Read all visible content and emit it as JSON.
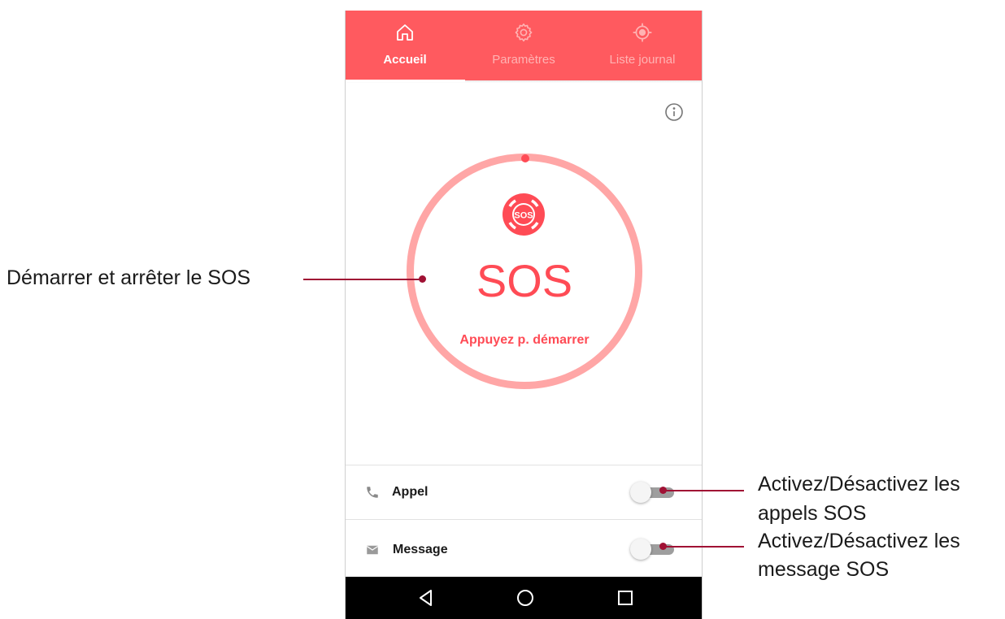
{
  "tabs": [
    {
      "label": "Accueil",
      "icon": "home-icon",
      "active": true
    },
    {
      "label": "Paramètres",
      "icon": "gear-icon",
      "active": false
    },
    {
      "label": "Liste journal",
      "icon": "location-target-icon",
      "active": false
    }
  ],
  "sos": {
    "title": "SOS",
    "logo_text": "SOS",
    "subtitle": "Appuyez p. démarrer"
  },
  "rows": [
    {
      "label": "Appel",
      "icon": "phone-icon",
      "enabled": false
    },
    {
      "label": "Message",
      "icon": "mail-icon",
      "enabled": false
    }
  ],
  "navbar": {
    "buttons": [
      "back-icon",
      "home-circle-icon",
      "recents-square-icon"
    ]
  },
  "annotations": {
    "sos_button": "Démarrer et arrêter le SOS",
    "call_toggle_line1": "Activez/Désactivez les",
    "call_toggle_line2": "appels SOS",
    "message_toggle_line1": "Activez/Désactivez les",
    "message_toggle_line2": "message SOS"
  },
  "colors": {
    "accent": "#ff5a5f",
    "sos_red": "#ff4b55",
    "ring": "#ffa6a6",
    "annotation": "#a01134"
  }
}
